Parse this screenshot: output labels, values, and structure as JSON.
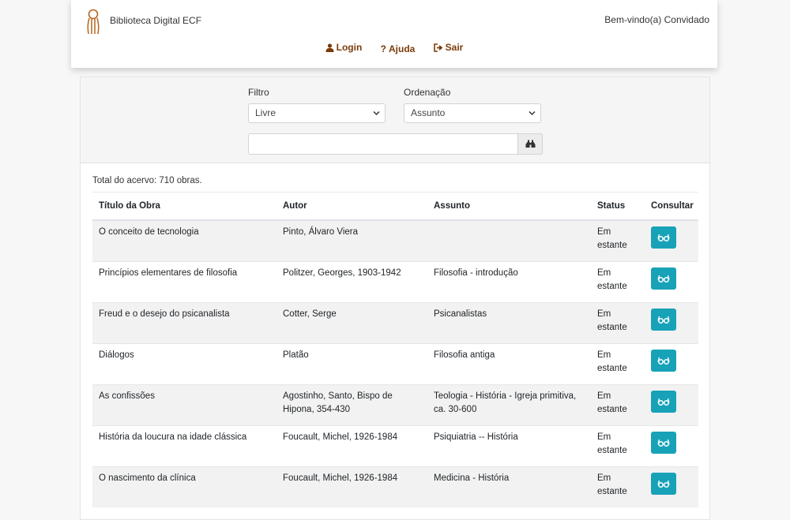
{
  "header": {
    "brand": "Biblioteca Digital ECF",
    "welcome": "Bem-vindo(a) Convidado",
    "nav": {
      "login": "Login",
      "help": "Ajuda",
      "exit": "Sair"
    }
  },
  "filters": {
    "filter_label": "Filtro",
    "filter_value": "Livre",
    "order_label": "Ordenação",
    "order_value": "Assunto",
    "search_value": ""
  },
  "total_text": "Total do acervo: 710 obras.",
  "table": {
    "columns": [
      "Título da Obra",
      "Autor",
      "Assunto",
      "Status",
      "Consultar"
    ],
    "rows": [
      {
        "title": "O conceito de tecnologia",
        "author": "Pinto, Álvaro Viera",
        "subject": "",
        "status": "Em estante"
      },
      {
        "title": "Princípios elementares de filosofia",
        "author": "Politzer, Georges, 1903-1942",
        "subject": "Filosofia - introdução",
        "status": "Em estante"
      },
      {
        "title": "Freud e o desejo do psicanalista",
        "author": "Cotter, Serge",
        "subject": "Psicanalistas",
        "status": "Em estante"
      },
      {
        "title": "Diálogos",
        "author": "Platão",
        "subject": "Filosofia antiga",
        "status": "Em estante"
      },
      {
        "title": "As confissões",
        "author": "Agostinho, Santo, Bispo de Hipona, 354-430",
        "subject": "Teologia - História - Igreja primitiva, ca. 30-600",
        "status": "Em estante"
      },
      {
        "title": "História da loucura na idade clássica",
        "author": "Foucault, Michel, 1926-1984",
        "subject": "Psiquiatria -- História",
        "status": "Em estante"
      },
      {
        "title": "O nascimento da clínica",
        "author": "Foucault, Michel, 1926-1984",
        "subject": "Medicina - História",
        "status": "Em estante"
      }
    ]
  },
  "colors": {
    "accent": "#17a2b8",
    "nav_link": "#7a3b08",
    "logo": "#b5651d"
  },
  "icons": {
    "logo": "library-logo-icon",
    "login": "user-icon",
    "help": "question-icon",
    "exit": "sign-out-icon",
    "search": "binoculars-icon",
    "consult": "glasses-icon",
    "select": "chevron-down-icon"
  }
}
